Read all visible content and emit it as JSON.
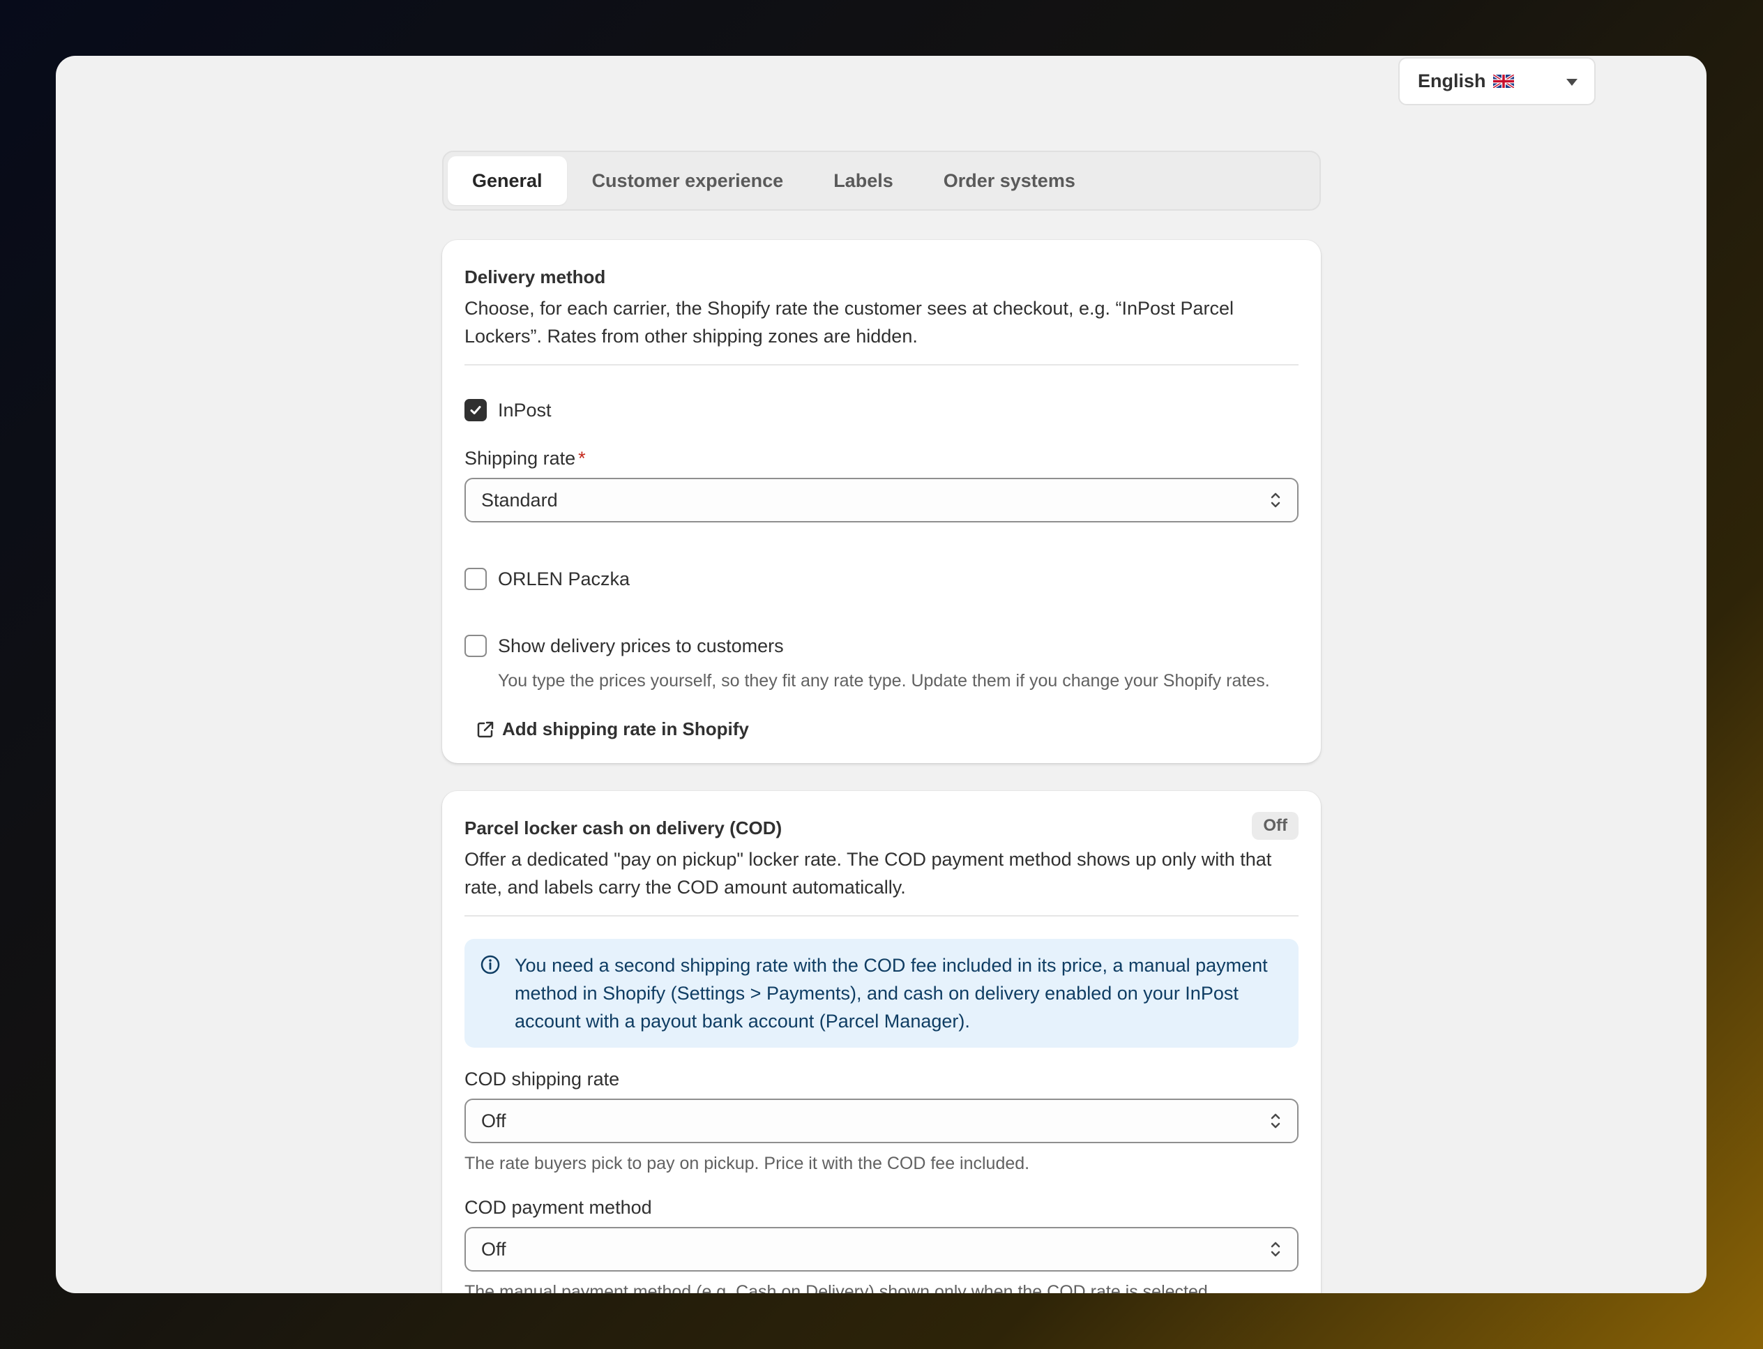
{
  "language": {
    "label": "English",
    "flag": "🇬🇧"
  },
  "tabs": [
    {
      "label": "General",
      "active": true
    },
    {
      "label": "Customer experience",
      "active": false
    },
    {
      "label": "Labels",
      "active": false
    },
    {
      "label": "Order systems",
      "active": false
    }
  ],
  "delivery": {
    "title": "Delivery method",
    "description": "Choose, for each carrier, the Shopify rate the customer sees at checkout, e.g. “InPost Parcel Lockers”. Rates from other shipping zones are hidden.",
    "inpost": {
      "label": "InPost",
      "checked": true
    },
    "shipping_rate": {
      "label": "Shipping rate",
      "required_mark": "*",
      "value": "Standard"
    },
    "orlen": {
      "label": "ORLEN Paczka",
      "checked": false
    },
    "show_prices": {
      "label": "Show delivery prices to customers",
      "checked": false,
      "help": "You type the prices yourself, so they fit any rate type. Update them if you change your Shopify rates."
    },
    "add_rate_link": "Add shipping rate in Shopify"
  },
  "cod": {
    "title": "Parcel locker cash on delivery (COD)",
    "badge": "Off",
    "description": "Offer a dedicated \"pay on pickup\" locker rate. The COD payment method shows up only with that rate, and labels carry the COD amount automatically.",
    "banner": "You need a second shipping rate with the COD fee included in its price, a manual payment method in Shopify (Settings > Payments), and cash on delivery enabled on your InPost account with a payout bank account (Parcel Manager).",
    "shipping_rate": {
      "label": "COD shipping rate",
      "value": "Off",
      "help": "The rate buyers pick to pay on pickup. Price it with the COD fee included."
    },
    "payment_method": {
      "label": "COD payment method",
      "value": "Off",
      "help": "The manual payment method (e.g. Cash on Delivery) shown only when the COD rate is selected."
    }
  },
  "colors": {
    "background": "#f1f1f1",
    "card": "#ffffff",
    "banner": "#e6f2fc",
    "required": "#c5281c",
    "checked": "#303030"
  }
}
